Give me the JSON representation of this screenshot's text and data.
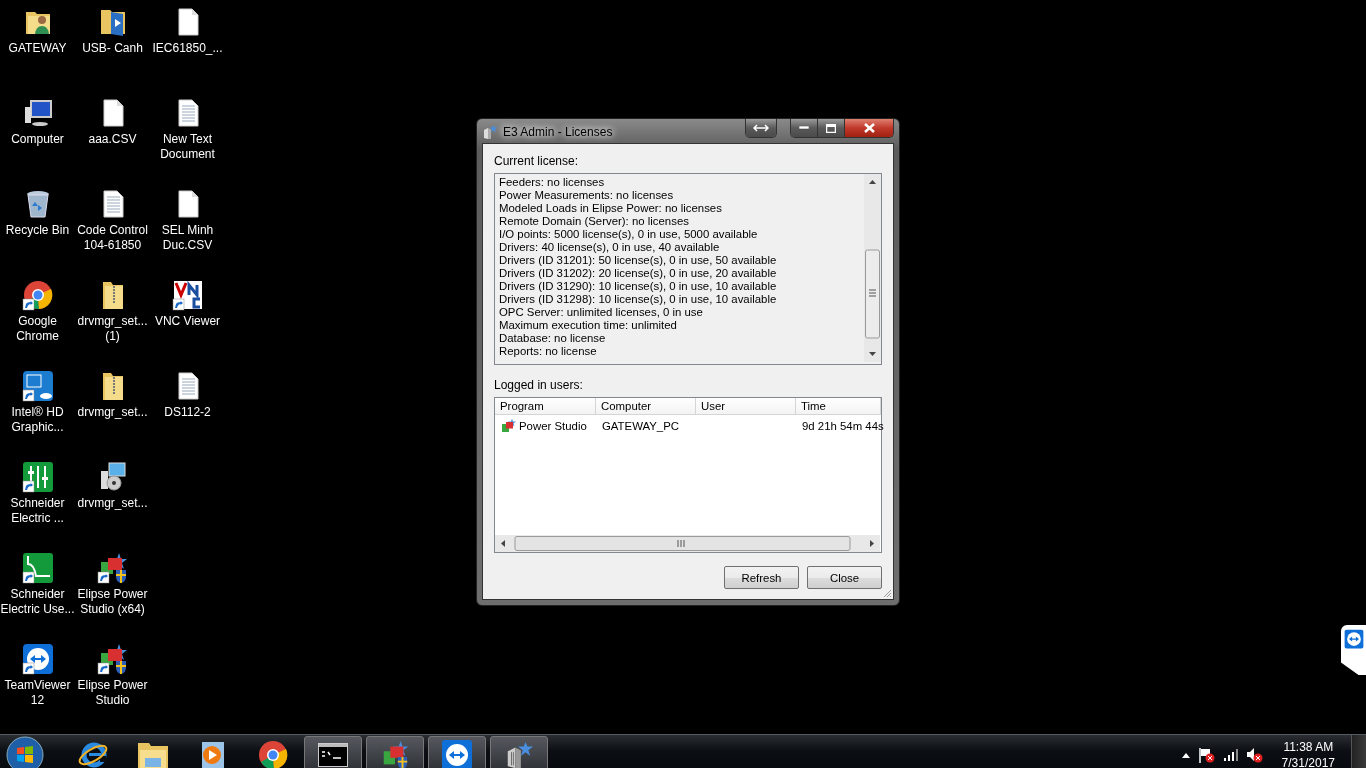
{
  "desktop_icons": [
    {
      "label": "GATEWAY",
      "kind": "folder-person",
      "shortcut": false
    },
    {
      "label": "Computer",
      "kind": "computer",
      "shortcut": false
    },
    {
      "label": "Recycle Bin",
      "kind": "recycle",
      "shortcut": false
    },
    {
      "label": "Google Chrome",
      "kind": "chrome",
      "shortcut": true
    },
    {
      "label": "Intel® HD Graphic...",
      "kind": "intel",
      "shortcut": true
    },
    {
      "label": "Schneider Electric ...",
      "kind": "schneider",
      "shortcut": true
    },
    {
      "label": "Schneider Electric Use...",
      "kind": "schneider-curve",
      "shortcut": true
    },
    {
      "label": "TeamViewer 12",
      "kind": "teamviewer",
      "shortcut": true
    },
    {
      "label": "USB- Canh",
      "kind": "folder-media",
      "shortcut": false
    },
    {
      "label": "aaa.CSV",
      "kind": "file",
      "shortcut": false
    },
    {
      "label": "Code Control 104-61850",
      "kind": "textfile",
      "shortcut": false
    },
    {
      "label": "drvmgr_set... (1)",
      "kind": "zip",
      "shortcut": false
    },
    {
      "label": "drvmgr_set...",
      "kind": "zip",
      "shortcut": false
    },
    {
      "label": "drvmgr_set...",
      "kind": "installer",
      "shortcut": false
    },
    {
      "label": "Elipse Power Studio (x64)",
      "kind": "elipse",
      "shortcut": true
    },
    {
      "label": "Elipse Power Studio",
      "kind": "elipse",
      "shortcut": true
    },
    {
      "label": "IEC61850_...",
      "kind": "file",
      "shortcut": false
    },
    {
      "label": "New Text Document",
      "kind": "textfile",
      "shortcut": false
    },
    {
      "label": "SEL Minh Duc.CSV",
      "kind": "file",
      "shortcut": false
    },
    {
      "label": "VNC Viewer",
      "kind": "vnc",
      "shortcut": true
    },
    {
      "label": "DS112-2",
      "kind": "textfile",
      "shortcut": false
    }
  ],
  "window": {
    "title": "E3 Admin - Licenses",
    "current_license_label": "Current license:",
    "license_lines": [
      "Feeders: no licenses",
      "Power Measurements: no licenses",
      "Modeled Loads in Elipse Power: no licenses",
      "Remote Domain (Server): no licenses",
      "I/O points: 5000 license(s), 0 in use, 5000 available",
      "Drivers: 40 license(s), 0 in use, 40 available",
      "Drivers (ID 31201): 50 license(s), 0 in use, 50 available",
      "Drivers (ID 31202): 20 license(s), 0 in use, 20 available",
      "Drivers (ID 31290): 10 license(s), 0 in use, 10 available",
      "Drivers (ID 31298): 10 license(s), 0 in use, 10 available",
      "OPC Server: unlimited licenses, 0 in use",
      "Maximum execution time: unlimited",
      "Database: no license",
      "Reports: no license"
    ],
    "users_label": "Logged in users:",
    "users_table": {
      "columns": [
        "Program",
        "Computer",
        "User",
        "Time"
      ],
      "rows": [
        {
          "program": "Power Studio",
          "computer": "GATEWAY_PC",
          "time": "9d 21h 54m 44s"
        }
      ]
    },
    "buttons": [
      "Refresh",
      "Close"
    ]
  },
  "taskbar": {
    "items": [
      {
        "kind": "ie",
        "running": false
      },
      {
        "kind": "explorer",
        "running": false
      },
      {
        "kind": "media",
        "running": false
      },
      {
        "kind": "chrome",
        "running": false
      },
      {
        "kind": "console",
        "running": true
      },
      {
        "kind": "elipse",
        "running": true
      },
      {
        "kind": "teamviewer",
        "running": true
      },
      {
        "kind": "e3",
        "running": true
      }
    ],
    "clock": {
      "time": "11:38 AM",
      "date": "7/31/2017"
    }
  }
}
